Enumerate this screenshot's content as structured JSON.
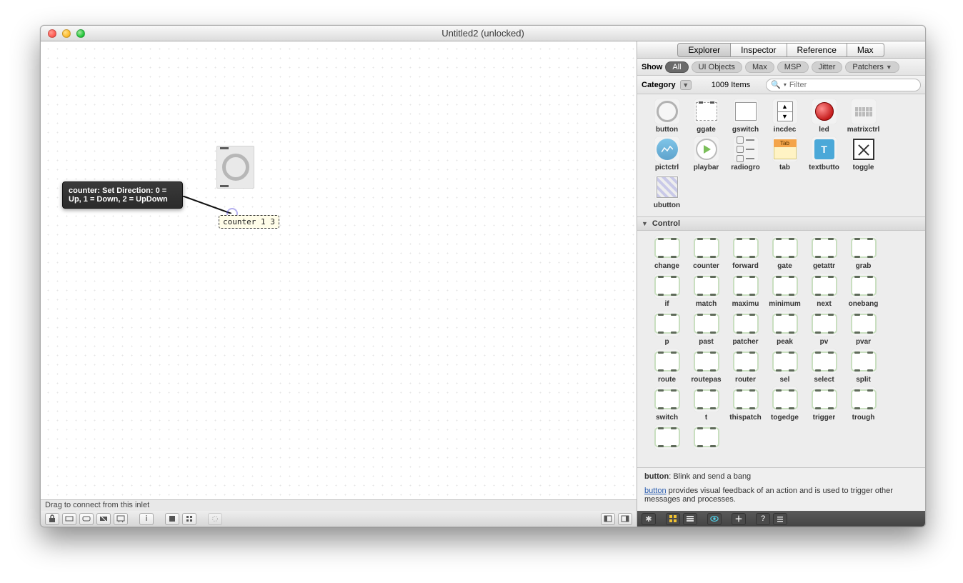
{
  "window": {
    "title": "Untitled2 (unlocked)"
  },
  "canvas": {
    "object_text": "counter 1 3",
    "tooltip": "counter: Set Direction: 0 = Up, 1 = Down, 2 = UpDown",
    "status": "Drag to connect from this inlet"
  },
  "tabs": {
    "explorer": "Explorer",
    "inspector": "Inspector",
    "reference": "Reference",
    "max": "Max",
    "active": "Explorer"
  },
  "filters": {
    "show_label": "Show",
    "all": "All",
    "ui": "UI Objects",
    "max": "Max",
    "msp": "MSP",
    "jitter": "Jitter",
    "patchers": "Patchers"
  },
  "category": {
    "label": "Category",
    "items_count": "1009 Items",
    "search_placeholder": "Filter"
  },
  "ui_section": {
    "items": [
      {
        "id": "button",
        "label": "button"
      },
      {
        "id": "ggate",
        "label": "ggate"
      },
      {
        "id": "gswitch",
        "label": "gswitch"
      },
      {
        "id": "incdec",
        "label": "incdec"
      },
      {
        "id": "led",
        "label": "led"
      },
      {
        "id": "matrixctrl",
        "label": "matrixctrl"
      },
      {
        "id": "pictctrl",
        "label": "pictctrl"
      },
      {
        "id": "playbar",
        "label": "playbar"
      },
      {
        "id": "radiogroup",
        "label": "radiogro"
      },
      {
        "id": "tab",
        "label": "tab"
      },
      {
        "id": "textbutton",
        "label": "textbutto"
      },
      {
        "id": "toggle",
        "label": "toggle"
      },
      {
        "id": "ubutton",
        "label": "ubutton"
      }
    ]
  },
  "control_section": {
    "header": "Control",
    "items": [
      {
        "label": "change"
      },
      {
        "label": "counter"
      },
      {
        "label": "forward"
      },
      {
        "label": "gate"
      },
      {
        "label": "getattr"
      },
      {
        "label": "grab"
      },
      {
        "label": "if"
      },
      {
        "label": "match"
      },
      {
        "label": "maximu"
      },
      {
        "label": "minimum"
      },
      {
        "label": "next"
      },
      {
        "label": "onebang"
      },
      {
        "label": "p"
      },
      {
        "label": "past"
      },
      {
        "label": "patcher"
      },
      {
        "label": "peak"
      },
      {
        "label": "pv"
      },
      {
        "label": "pvar"
      },
      {
        "label": "route"
      },
      {
        "label": "routepas"
      },
      {
        "label": "router"
      },
      {
        "label": "sel"
      },
      {
        "label": "select"
      },
      {
        "label": "split"
      },
      {
        "label": "switch"
      },
      {
        "label": "t"
      },
      {
        "label": "thispatch"
      },
      {
        "label": "togedge"
      },
      {
        "label": "trigger"
      },
      {
        "label": "trough"
      },
      {
        "label": ""
      },
      {
        "label": ""
      }
    ]
  },
  "info": {
    "bold": "button",
    "short": ": Blink and send a bang",
    "link": "button",
    "long": " provides visual feedback of an action and is used to trigger other messages and processes."
  }
}
